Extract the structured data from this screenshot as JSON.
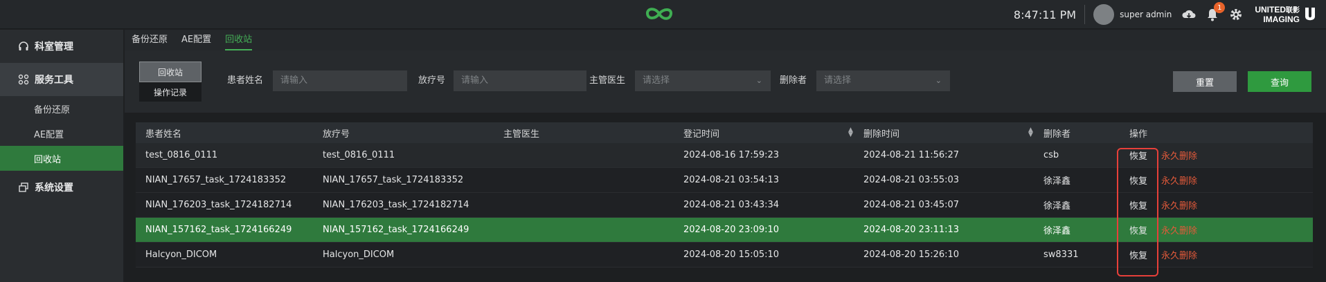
{
  "header": {
    "time": "8:47:11 PM",
    "username": "super admin",
    "notification_count": "1",
    "brand_line1": "UNITED",
    "brand_line1_cn": "联影",
    "brand_line2": "IMAGING",
    "logo_icon": "infinity-logo-icon"
  },
  "sidebar": {
    "items": [
      {
        "label": "科室管理",
        "icon": "headset-icon"
      },
      {
        "label": "服务工具",
        "icon": "grid-icon",
        "children": [
          "备份还原",
          "AE配置",
          "回收站"
        ],
        "active_child": "回收站"
      },
      {
        "label": "系统设置",
        "icon": "window-icon"
      }
    ]
  },
  "subtabs": [
    "备份还原",
    "AE配置",
    "回收站"
  ],
  "filter": {
    "seg_top": "回收站",
    "seg_bottom": "操作记录",
    "patient_label": "患者姓名",
    "patient_placeholder": "请输入",
    "treatment_label": "放疗号",
    "treatment_placeholder": "请输入",
    "doctor_label": "主管医生",
    "doctor_placeholder": "请选择",
    "deleter_label": "删除者",
    "deleter_placeholder": "请选择",
    "reset_label": "重置",
    "query_label": "查询"
  },
  "table": {
    "headers": [
      "患者姓名",
      "放疗号",
      "主管医生",
      "登记时间",
      "删除时间",
      "删除者",
      "操作"
    ],
    "restore_label": "恢复",
    "delete_label": "永久删除",
    "rows": [
      {
        "name": "test_0816_0111",
        "id": "test_0816_0111",
        "doctor": "",
        "reg": "2024-08-16 17:59:23",
        "del": "2024-08-21 11:56:27",
        "by": "csb"
      },
      {
        "name": "NIAN_17657_task_1724183352",
        "id": "NIAN_17657_task_1724183352",
        "doctor": "",
        "reg": "2024-08-21 03:54:13",
        "del": "2024-08-21 03:55:03",
        "by": "徐泽鑫"
      },
      {
        "name": "NIAN_176203_task_1724182714",
        "id": "NIAN_176203_task_1724182714",
        "doctor": "",
        "reg": "2024-08-21 03:43:34",
        "del": "2024-08-21 03:45:07",
        "by": "徐泽鑫"
      },
      {
        "name": "NIAN_157162_task_1724166249",
        "id": "NIAN_157162_task_1724166249",
        "doctor": "",
        "reg": "2024-08-20 23:09:10",
        "del": "2024-08-20 23:11:13",
        "by": "徐泽鑫"
      },
      {
        "name": "Halcyon_DICOM",
        "id": "Halcyon_DICOM",
        "doctor": "",
        "reg": "2024-08-20 15:05:10",
        "del": "2024-08-20 15:26:10",
        "by": "sw8331"
      }
    ]
  },
  "colors": {
    "accent": "#45b057",
    "selected_row": "#2f7a3d",
    "danger": "#e35a3a",
    "highlight_box": "#e8403a"
  }
}
